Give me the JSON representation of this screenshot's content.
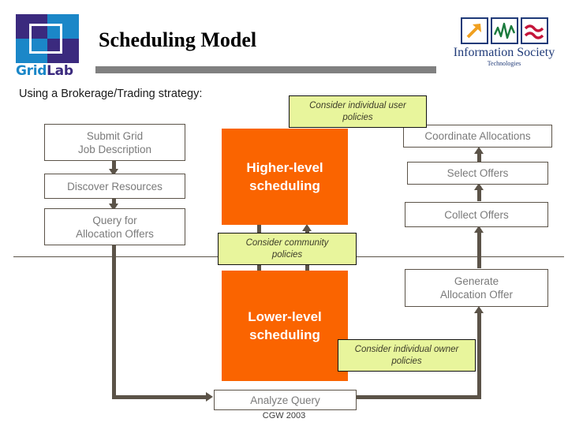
{
  "slide": {
    "title": "Scheduling Model",
    "intro": "Using a Brokerage/Trading strategy:",
    "footer": "CGW 2003",
    "colors": {
      "orange": "#fa6400",
      "callout_yellow": "#e8f59c",
      "connector": "#5b5348",
      "rule_gray": "#808080",
      "logo_purple": "#3b2a7e",
      "logo_blue": "#1b87c8",
      "ist_navy": "#1f3a78"
    }
  },
  "gridlab_logo": {
    "name_part1": "Grid",
    "name_part2": "Lab",
    "icon": "gridlab-squares-icon"
  },
  "ist_logo": {
    "name": "Information Society",
    "subtitle": "Technologies",
    "icons": [
      "arrow-up-right-icon",
      "zigzag-line-icon",
      "double-wave-icon"
    ]
  },
  "left_column": [
    {
      "label": "Submit Grid\nJob Description",
      "line1": "Submit Grid",
      "line2": "Job Description"
    },
    {
      "label": "Discover Resources",
      "line1": "Discover Resources",
      "line2": ""
    },
    {
      "label": "Query for\nAllocation Offers",
      "line1": "Query for",
      "line2": "Allocation Offers"
    }
  ],
  "center_column": [
    {
      "line1": "Higher-level",
      "line2": "scheduling"
    },
    {
      "line1": "Lower-level",
      "line2": "scheduling"
    }
  ],
  "right_column": [
    {
      "line1": "Coordinate Allocations",
      "line2": ""
    },
    {
      "line1": "Select Offers",
      "line2": ""
    },
    {
      "line1": "Collect Offers",
      "line2": ""
    },
    {
      "line1": "Generate",
      "line2": "Allocation Offer"
    }
  ],
  "bottom_box": {
    "line1": "Analyze Query",
    "line2": ""
  },
  "callouts": [
    {
      "line1": "Consider individual user",
      "line2": "policies"
    },
    {
      "line1": "Consider community",
      "line2": "policies"
    },
    {
      "line1": "Consider individual owner",
      "line2": "policies"
    }
  ]
}
